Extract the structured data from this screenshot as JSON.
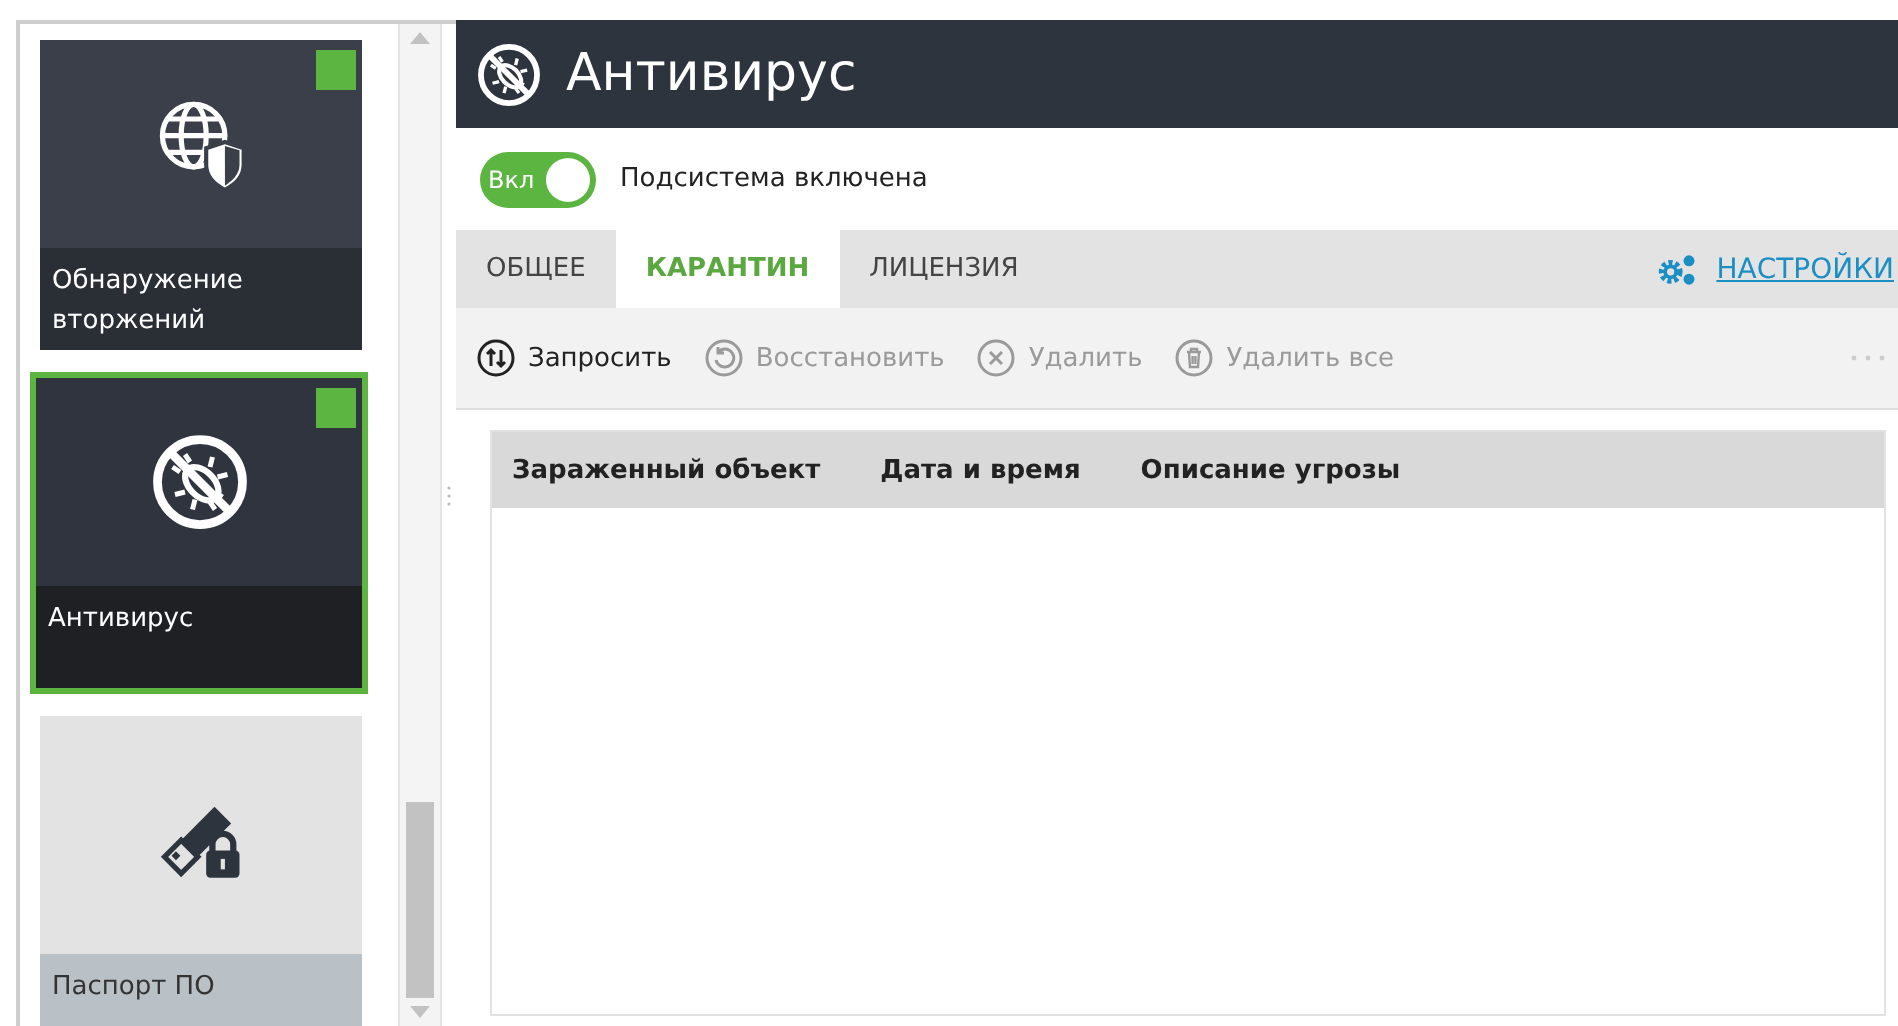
{
  "sidebar": {
    "items": [
      {
        "label": "Обнаружение вторжений",
        "kind": "globe-shield",
        "selected": false,
        "status_on": true,
        "disabled": false
      },
      {
        "label": "Антивирус",
        "kind": "no-bug",
        "selected": true,
        "status_on": true,
        "disabled": false
      },
      {
        "label": "Паспорт ПО",
        "kind": "usb-lock",
        "selected": false,
        "status_on": false,
        "disabled": true
      }
    ]
  },
  "header": {
    "title": "Антивирус"
  },
  "subsystem": {
    "toggle_label": "Вкл",
    "on": true,
    "status_text": "Подсистема включена"
  },
  "tabs": [
    {
      "label": "ОБЩЕЕ",
      "selected": false
    },
    {
      "label": "КАРАНТИН",
      "selected": true
    },
    {
      "label": "ЛИЦЕНЗИЯ",
      "selected": false
    }
  ],
  "settings_link": "НАСТРОЙКИ",
  "toolbar": [
    {
      "label": "Запросить",
      "kind": "request",
      "disabled": false
    },
    {
      "label": "Восстановить",
      "kind": "restore",
      "disabled": true
    },
    {
      "label": "Удалить",
      "kind": "delete",
      "disabled": true
    },
    {
      "label": "Удалить все",
      "kind": "delete-all",
      "disabled": true
    }
  ],
  "table": {
    "columns": [
      "Зараженный объект",
      "Дата и время",
      "Описание угрозы"
    ]
  }
}
